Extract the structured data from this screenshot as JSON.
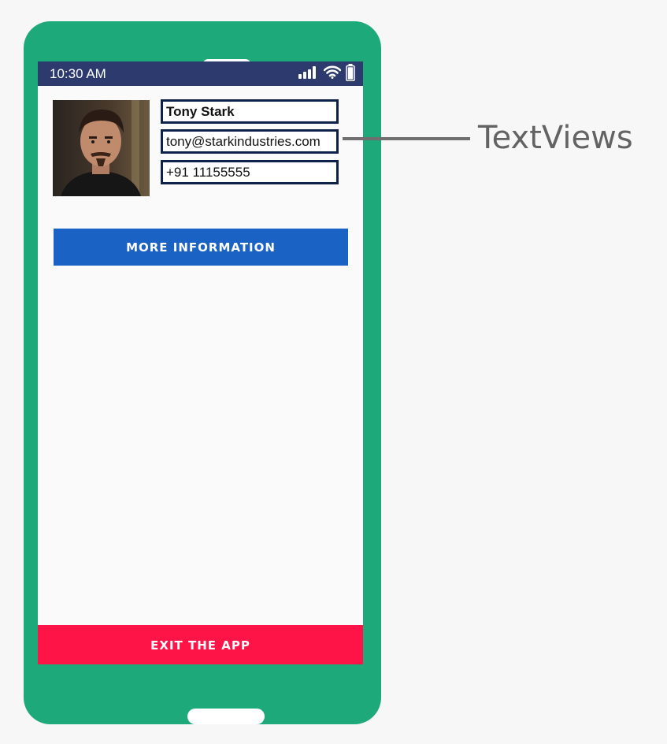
{
  "status_bar": {
    "time": "10:30 AM",
    "icons": [
      "signal-icon",
      "wifi-icon",
      "battery-icon"
    ]
  },
  "profile": {
    "name": "Tony Stark",
    "email": "tony@starkindustries.com",
    "phone": "+91 11155555"
  },
  "buttons": {
    "more_info": "MORE INFORMATION",
    "exit": "EXIT THE APP"
  },
  "annotation": {
    "label": "TextViews"
  },
  "colors": {
    "phone_body": "#1ea97a",
    "status_bar": "#2c3a6e",
    "more_button": "#1a63c4",
    "exit_button": "#ff1448",
    "textview_border": "#0e2148"
  }
}
